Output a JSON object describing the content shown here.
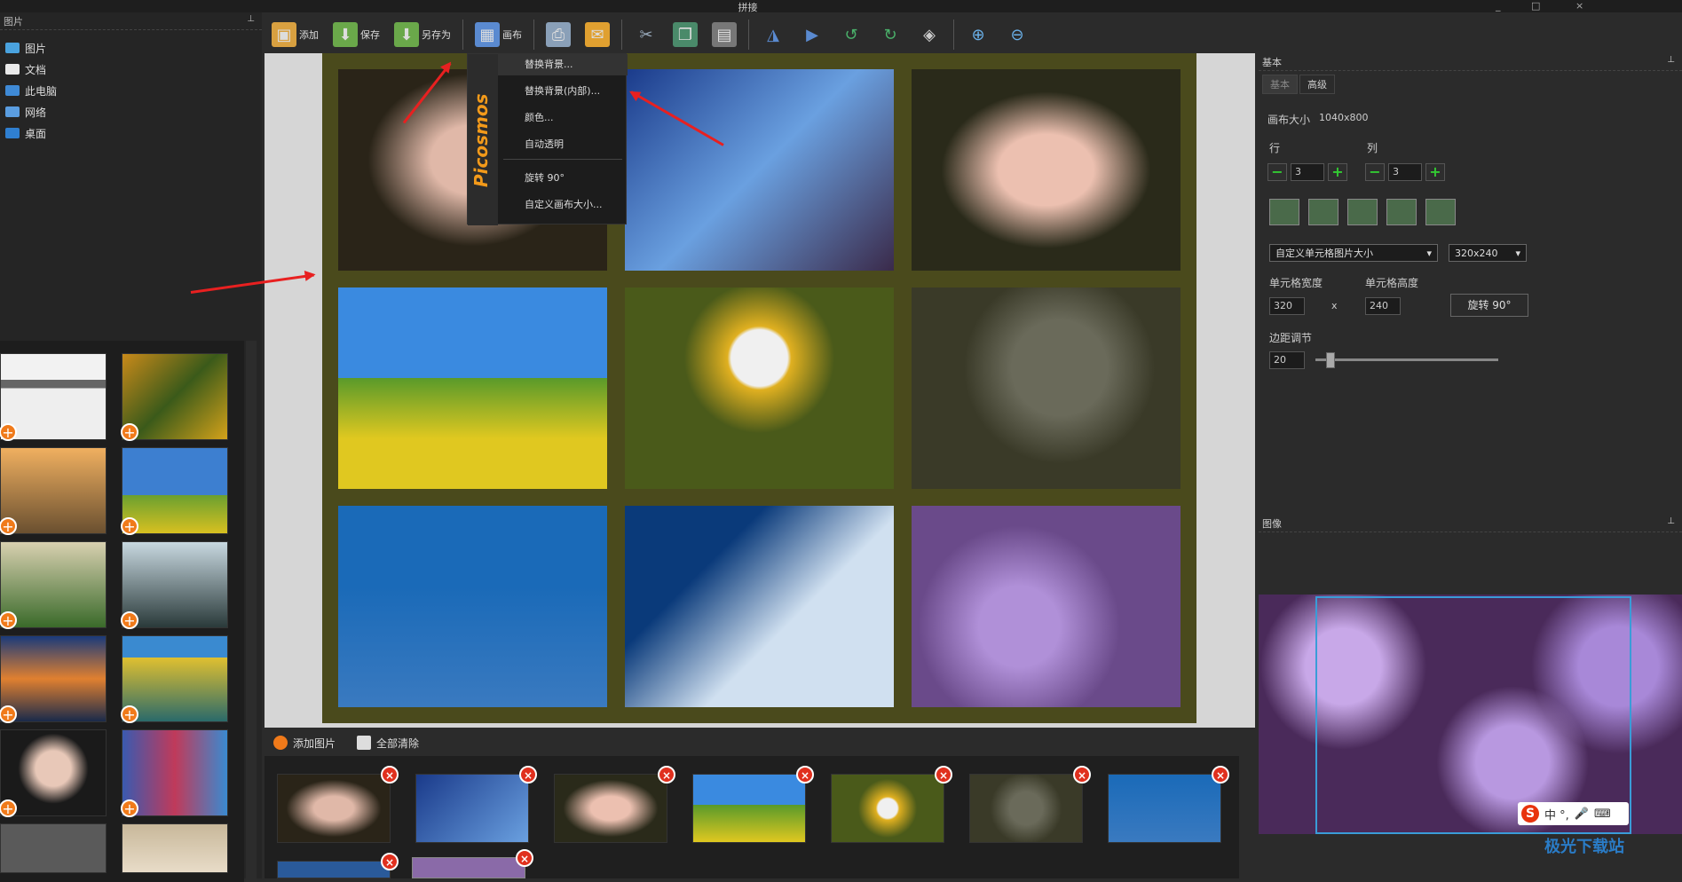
{
  "window": {
    "title": "拼接",
    "controls": [
      "_",
      "□",
      "×"
    ]
  },
  "toolbar": {
    "add": "添加",
    "save": "保存",
    "save_as": "另存为",
    "canvas": "画布"
  },
  "left_panel": {
    "header": "图片",
    "tree": [
      {
        "label": "图片",
        "icon": "pictures-folder-icon"
      },
      {
        "label": "文档",
        "icon": "documents-folder-icon"
      },
      {
        "label": "此电脑",
        "icon": "computer-icon"
      },
      {
        "label": "网络",
        "icon": "network-icon"
      },
      {
        "label": "桌面",
        "icon": "desktop-icon"
      }
    ]
  },
  "canvas_menu": {
    "brand": "Picosmos",
    "items": [
      {
        "label": "替换背景..."
      },
      {
        "label": "替换背景(内部)..."
      },
      {
        "label": "颜色..."
      },
      {
        "label": "自动透明"
      },
      {
        "label": "旋转 90°"
      },
      {
        "label": "自定义画布大小..."
      }
    ]
  },
  "bottom_bar": {
    "add_images": "添加图片",
    "clear_all": "全部清除"
  },
  "right_panel": {
    "header": "基本",
    "tabs": [
      {
        "label": "基本",
        "active": true
      },
      {
        "label": "高级",
        "active": false
      }
    ],
    "canvas_size_label": "画布大小",
    "canvas_size_value": "1040x800",
    "rows_label": "行",
    "cols_label": "列",
    "rows_value": "3",
    "cols_value": "3",
    "cell_size_select": "自定义单元格图片大小",
    "cell_dims_select": "320x240",
    "cell_width_label": "单元格宽度",
    "cell_height_label": "单元格高度",
    "cell_width_value": "320",
    "cell_height_value": "240",
    "times_sign": "x",
    "rotate_btn": "旋转 90°",
    "margin_label": "边距调节",
    "margin_value": "20"
  },
  "image_panel": {
    "header": "图像"
  },
  "ime": {
    "logo": "S",
    "text": "中 °,"
  },
  "watermark": "极光下载站",
  "colors": {
    "canvas_bg": "#4a4a1c",
    "accent_orange": "#f07a1a",
    "remove_red": "#e0301e",
    "selection_blue": "#3a9cd8",
    "annotation_red": "#e82020"
  }
}
